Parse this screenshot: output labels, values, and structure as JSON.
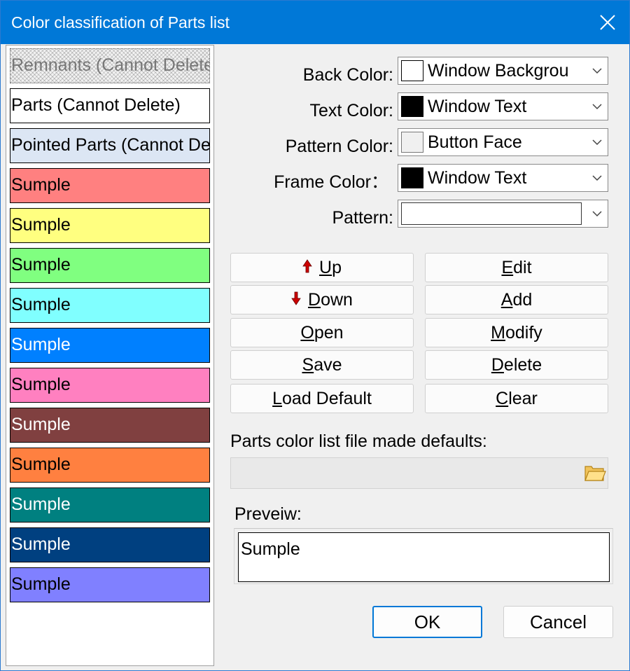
{
  "window": {
    "title": "Color classification of Parts list"
  },
  "color_list": {
    "items": [
      {
        "label": "Remnants (Cannot Delete)",
        "bg": "#f2f2f2",
        "fg": "#777777",
        "style": "hatched"
      },
      {
        "label": "Parts (Cannot Delete)",
        "bg": "#ffffff",
        "fg": "#000000"
      },
      {
        "label": "Pointed Parts (Cannot Delete)",
        "bg": "#dce6f4",
        "fg": "#000000"
      },
      {
        "label": "Sumple",
        "bg": "#ff8080",
        "fg": "#000000"
      },
      {
        "label": "Sumple",
        "bg": "#ffff80",
        "fg": "#000000"
      },
      {
        "label": "Sumple",
        "bg": "#80ff80",
        "fg": "#000000"
      },
      {
        "label": "Sumple",
        "bg": "#80ffff",
        "fg": "#000000"
      },
      {
        "label": "Sumple",
        "bg": "#0080ff",
        "fg": "#ffffff"
      },
      {
        "label": "Sumple",
        "bg": "#ff80c0",
        "fg": "#000000"
      },
      {
        "label": "Sumple",
        "bg": "#804040",
        "fg": "#ffffff"
      },
      {
        "label": "Sumple",
        "bg": "#ff8040",
        "fg": "#000000"
      },
      {
        "label": "Sumple",
        "bg": "#008080",
        "fg": "#ffffff"
      },
      {
        "label": "Sumple",
        "bg": "#004080",
        "fg": "#ffffff"
      },
      {
        "label": "Sumple",
        "bg": "#8080ff",
        "fg": "#000000"
      }
    ]
  },
  "properties": {
    "back_color": {
      "label": "Back Color:",
      "value": "Window Backgrou",
      "swatch": "#ffffff"
    },
    "text_color": {
      "label": "Text Color:",
      "value": "Window Text",
      "swatch": "#000000"
    },
    "pattern_color": {
      "label": "Pattern Color:",
      "value": "Button Face",
      "swatch": "#f0f0f0"
    },
    "frame_color": {
      "label": "Frame Color：",
      "value": "Window Text",
      "swatch": "#000000"
    },
    "pattern": {
      "label": "Pattern:",
      "value": ""
    }
  },
  "buttons": {
    "up": "Up",
    "down": "Down",
    "open": "Open",
    "save": "Save",
    "load_default": "Load Default",
    "edit": "Edit",
    "add": "Add",
    "modify": "Modify",
    "delete": "Delete",
    "clear": "Clear"
  },
  "defaults_file": {
    "label": "Parts color list file made defaults:",
    "value": ""
  },
  "preview": {
    "label": "Preveiw:",
    "text": "Sumple"
  },
  "dialog": {
    "ok": "OK",
    "cancel": "Cancel"
  },
  "colors": {
    "accent": "#0078d7",
    "arrow_red": "#cc0000"
  }
}
